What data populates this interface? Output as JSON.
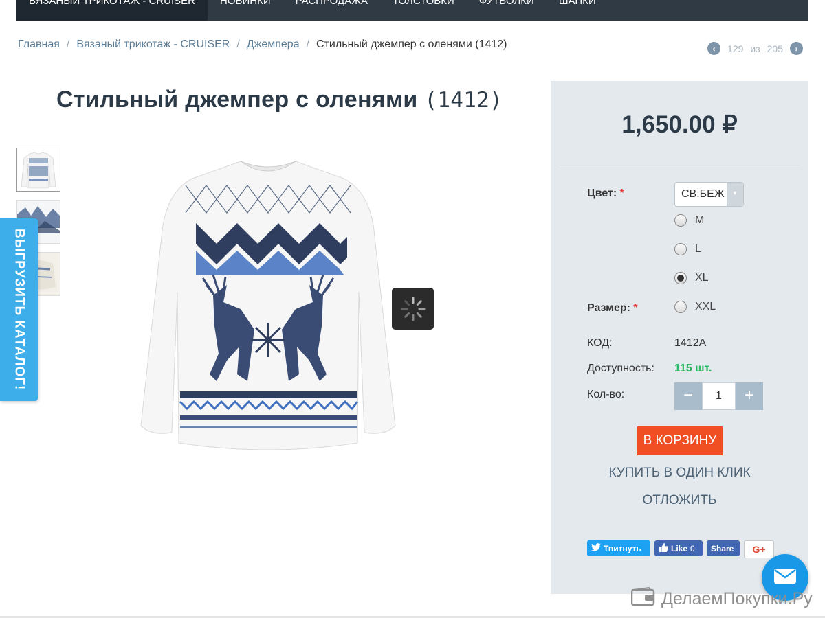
{
  "nav": {
    "items": [
      "ВЯЗАНЫЙ ТРИКОТАЖ - CRUISER",
      "НОВИНКИ",
      "РАСПРОДАЖА",
      "ТОЛСТОВКИ",
      "ФУТБОЛКИ",
      "ШАПКИ"
    ]
  },
  "breadcrumb": {
    "home": "Главная",
    "category": "Вязаный трикотаж - CRUISER",
    "subcategory": "Джемпера",
    "current": "Стильный джемпер с оленями (1412)",
    "separator": "/"
  },
  "pager": {
    "current": "129",
    "of_label": "из",
    "total": "205"
  },
  "product": {
    "title": "Стильный джемпер с оленями",
    "title_code": "(1412)"
  },
  "side_tab": {
    "label": "ВЫГРУЗИТЬ КАТАЛОГ!"
  },
  "buy_panel": {
    "price": "1,650.00 ₽",
    "color_label": "Цвет:",
    "required_mark": "*",
    "color_value": "СВ.БЕЖ",
    "size_label": "Размер:",
    "sizes": [
      {
        "label": "M",
        "checked": false
      },
      {
        "label": "L",
        "checked": false
      },
      {
        "label": "XL",
        "checked": true
      },
      {
        "label": "XXL",
        "checked": false
      }
    ],
    "code_label": "КОД:",
    "code_value": "1412A",
    "availability_label": "Доступность:",
    "availability_value": "115 шт.",
    "qty_label": "Кол-во:",
    "qty_value": "1",
    "qty_minus": "−",
    "qty_plus": "+",
    "cart_button": "В КОРЗИНУ",
    "one_click_button": "КУПИТЬ В ОДИН КЛИК",
    "wishlist_button": "ОТЛОЖИТЬ"
  },
  "share": {
    "twitter": "Твитнуть",
    "fb_like": "Like",
    "fb_like_count": "0",
    "fb_share": "Share",
    "gplus": "G+"
  },
  "watermark": {
    "text": "ДелаемПокупки.Ру"
  },
  "colors": {
    "nav_bg": "#2f3a45",
    "panel_bg": "#e4e9ee",
    "cart_button": "#f04e23",
    "availability": "#2ab764",
    "side_tab": "#3daee9"
  }
}
